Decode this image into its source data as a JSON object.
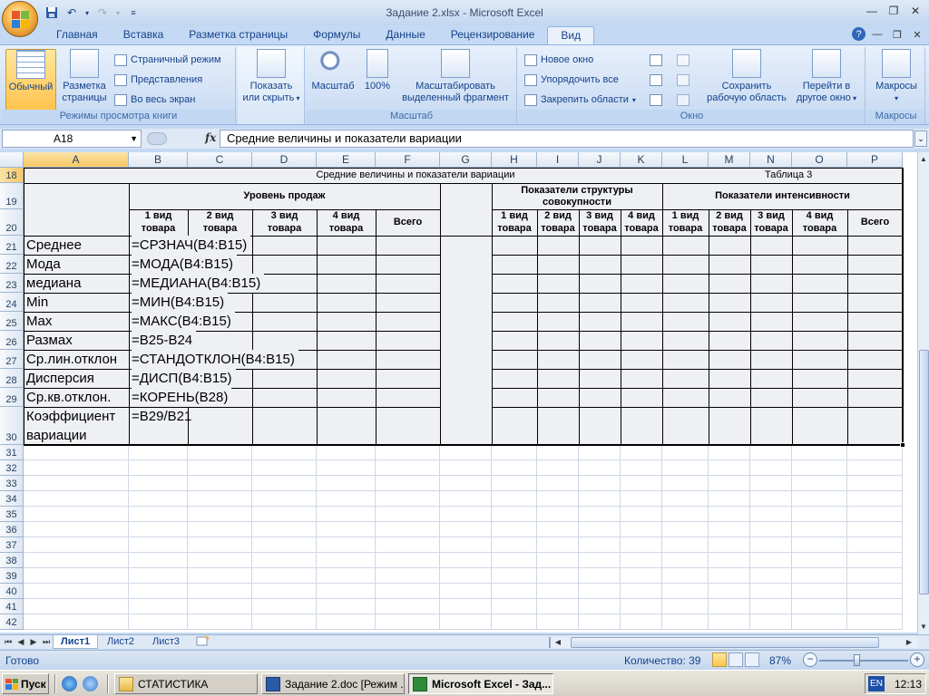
{
  "window": {
    "title": "Задание 2.xlsx - Microsoft Excel"
  },
  "ribbon": {
    "tabs": [
      "Главная",
      "Вставка",
      "Разметка страницы",
      "Формулы",
      "Данные",
      "Рецензирование",
      "Вид"
    ],
    "active_tab": "Вид",
    "groups": {
      "views": {
        "label": "Режимы просмотра книги",
        "normal": "Обычный",
        "page_layout_1": "Разметка",
        "page_layout_2": "страницы",
        "page_break": "Страничный режим",
        "custom_views": "Представления",
        "full_screen": "Во весь экран"
      },
      "show_hide": {
        "label_1": "Показать",
        "label_2": "или скрыть"
      },
      "zoom": {
        "label": "Масштаб",
        "zoom": "Масштаб",
        "hundred": "100%",
        "fit_1": "Масштабировать",
        "fit_2": "выделенный фрагмент"
      },
      "window": {
        "label": "Окно",
        "new_window": "Новое окно",
        "arrange_all": "Упорядочить все",
        "freeze_panes": "Закрепить области",
        "save_ws_1": "Сохранить",
        "save_ws_2": "рабочую область",
        "switch_1": "Перейти в",
        "switch_2": "другое окно"
      },
      "macros": {
        "label": "Макросы",
        "macros": "Макросы"
      }
    }
  },
  "formula_bar": {
    "name_box": "A18",
    "fx": "fx",
    "content": "Средние величины и показатели вариации"
  },
  "grid": {
    "columns": [
      "A",
      "B",
      "C",
      "D",
      "E",
      "F",
      "G",
      "H",
      "I",
      "J",
      "K",
      "L",
      "M",
      "N",
      "O",
      "P"
    ],
    "rows": [
      "18",
      "19",
      "20",
      "21",
      "22",
      "23",
      "24",
      "25",
      "26",
      "27",
      "28",
      "29",
      "30",
      "31",
      "32",
      "33",
      "34",
      "35",
      "36",
      "37",
      "38",
      "39",
      "40",
      "41",
      "42"
    ],
    "table": {
      "title": "Средние величины и показатели вариации",
      "table_no": "Таблица 3",
      "sales_header": "Уровень продаж",
      "structure_header_1": "Показатели структуры",
      "structure_header_2": "совокупности",
      "intensity_header": "Показатели интенсивности",
      "sub_headers": [
        {
          "l1": "1 вид",
          "l2": "товара"
        },
        {
          "l1": "2 вид",
          "l2": "товара"
        },
        {
          "l1": "3 вид",
          "l2": "товара"
        },
        {
          "l1": "4 вид",
          "l2": "товара"
        }
      ],
      "total": "Всего",
      "rows": [
        {
          "label": "Среднее",
          "formula": "=СРЗНАЧ(B4:B15)"
        },
        {
          "label": "Мода",
          "formula": "=МОДА(B4:B15)"
        },
        {
          "label": "медиана",
          "formula": "=МЕДИАНА(B4:B15)"
        },
        {
          "label": "Min",
          "formula": "=МИН(B4:B15)"
        },
        {
          "label": "Max",
          "formula": "=МАКС(B4:B15)"
        },
        {
          "label": "Размах",
          "formula": "=B25-B24"
        },
        {
          "label": "Ср.лин.отклон",
          "formula": "=СТАНДОТКЛОН(B4:B15)"
        },
        {
          "label": "Дисперсия",
          "formula": "=ДИСП(B4:B15)"
        },
        {
          "label": "Ср.кв.отклон.",
          "formula": "=КОРЕНЬ(B28)"
        },
        {
          "label": "Коэффициент",
          "label2": "вариации",
          "formula": "=B29/B21"
        }
      ]
    }
  },
  "sheets": {
    "tabs": [
      "Лист1",
      "Лист2",
      "Лист3"
    ],
    "active": "Лист1"
  },
  "status": {
    "ready": "Готово",
    "count": "Количество: 39",
    "zoom": "87%",
    "zoom_level_percent": 87
  },
  "taskbar": {
    "start": "Пуск",
    "tasks": [
      "СТАТИСТИКА",
      "Задание 2.doc [Режим ...",
      "Microsoft Excel - Зад..."
    ],
    "lang": "EN",
    "clock": "12:13"
  }
}
